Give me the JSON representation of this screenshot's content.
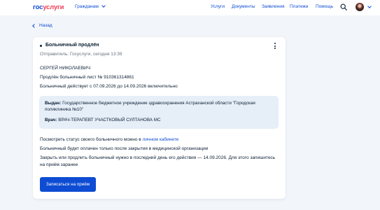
{
  "header": {
    "logo_part1": "гос",
    "logo_part2": "услуги",
    "audience_label": "Гражданам",
    "nav": [
      "Услуги",
      "Документы",
      "Заявления",
      "Платежи",
      "Помощь"
    ],
    "icons": [
      "search-icon",
      "avatar",
      "chevron-down-icon"
    ]
  },
  "back_label": "Назад",
  "card": {
    "title": "Больничный продлён",
    "meta": "Отправитель: Госуслуги, сегодня 13:39",
    "lines": [
      "СЕРГЕЙ НИКОЛАЕВИЧ",
      "Продлён больничный лист № 910361314861",
      "Больничный действует с 07.09.2026 до 14.09.2026 включительно"
    ],
    "info": {
      "issued_label": "Выдан:",
      "issued_value_1": "Государственное бюджетное учреждение здравоохранения Астраханской области \"Городская",
      "issued_value_2": "поликлиника №10\"",
      "doctor_label": "Врач:",
      "doctor_value": "ВРАЧ-ТЕРАПЕВТ УЧАСТКОВЫЙ СУЛТАНОВА МС"
    },
    "status_text": "Посмотреть статус своего больничного можно в",
    "status_link": "личном кабинете",
    "payment_text": "Больничный будет оплачен только после закрытия в медицинской организации",
    "close_text_1": "Закрыть или продлить больничный нужно в последний день его действия — 14.09.2026. Для этого запишитесь",
    "close_text_2": "на приём заранее",
    "button_label": "Записаться на приём"
  },
  "colors": {
    "accent": "#0d4cd3",
    "brand_red": "#ee3f58",
    "background": "#f2f6fb",
    "info_box": "#e6eef8"
  }
}
